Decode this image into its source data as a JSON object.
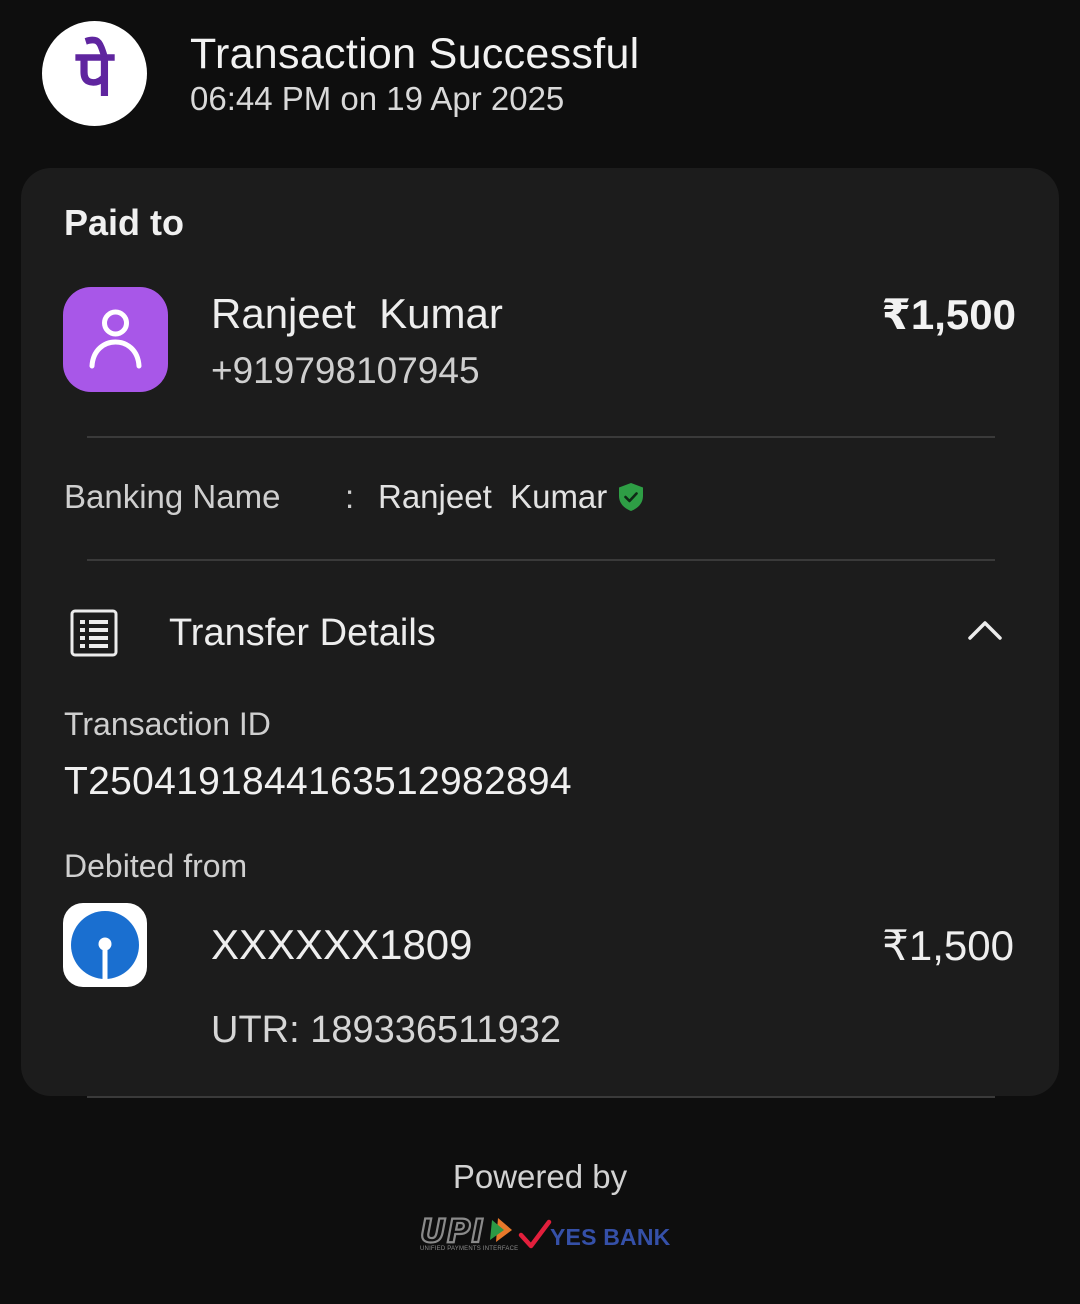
{
  "header": {
    "app_logo_glyph": "पे",
    "title": "Transaction Successful",
    "datetime": "06:44 PM on 19 Apr 2025"
  },
  "paid_to": {
    "section_label": "Paid to",
    "name": "Ranjeet  Kumar",
    "phone": "+919798107945",
    "amount": "₹1,500",
    "avatar_icon": "person-icon",
    "avatar_color": "#a857e8"
  },
  "banking": {
    "label": "Banking Name",
    "separator": ":",
    "value": "Ranjeet  Kumar",
    "verified_icon": "verified-shield-icon",
    "verified_color": "#2e9e45"
  },
  "transfer_details": {
    "label": "Transfer Details",
    "icon": "list-icon",
    "expanded_icon": "chevron-up-icon",
    "transaction_id_label": "Transaction ID",
    "transaction_id": "T2504191844163512982894",
    "debited_from_label": "Debited from",
    "account_number": "XXXXXX1809",
    "debit_amount": "₹1,500",
    "utr": "UTR: 189336511932",
    "bank_logo_icon": "bank-logo-icon",
    "bank_logo_color": "#1a6fd0"
  },
  "footer": {
    "powered_by": "Powered by",
    "upi_text": "UPI",
    "upi_subtext": "UNIFIED PAYMENTS INTERFACE",
    "partner_bank": "YES BANK",
    "partner_color": "#3550a8"
  },
  "colors": {
    "page_background": "#0e0e0e",
    "card_background": "#1c1c1c",
    "brand_purple": "#5f259f"
  }
}
